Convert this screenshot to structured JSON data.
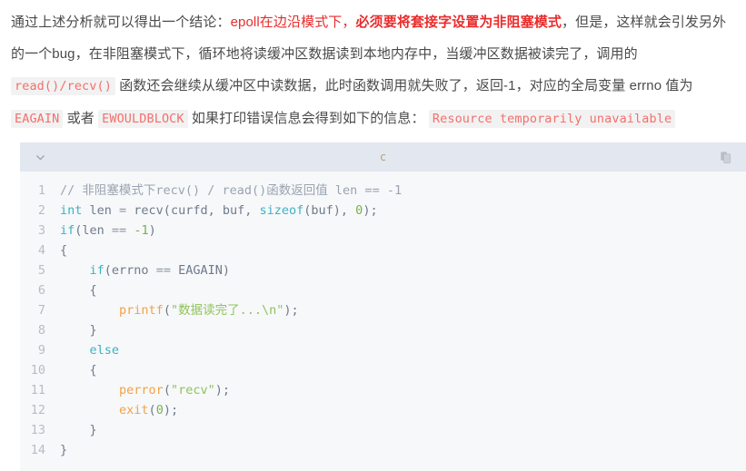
{
  "article": {
    "paragraph": {
      "seg1": "通过上述分析就可以得出一个结论：",
      "red1": "epoll在边沿模式下，",
      "red_bold": "必须要将套接字设置为非阻塞模式",
      "seg2": "，但是，这样就会引发另外的一个bug，在非阻塞模式下，循环地将读缓冲区数据读到本地内存中，当缓冲区数据被读完了，调用的 ",
      "code1": "read()/recv()",
      "seg3": " 函数还会继续从缓冲区中读数据，此时函数调用就失败了，返回-1，对应的全局变量 errno 值为 ",
      "code2": "EAGAIN",
      "seg4": " 或者 ",
      "code3": "EWOULDBLOCK",
      "seg5": " 如果打印错误信息会得到如下的信息： ",
      "code4": "Resource temporarily unavailable"
    }
  },
  "code_block": {
    "language_label": "c",
    "collapse_icon": "chevron-down-icon",
    "copy_icon": "copy-icon",
    "lines": [
      {
        "number": "1",
        "tokens": [
          {
            "text": "// 非阻塞模式下recv() / read()函数返回值 len == -1",
            "type": "comment"
          }
        ]
      },
      {
        "number": "2",
        "tokens": [
          {
            "text": "int",
            "type": "kw"
          },
          {
            "text": " len ",
            "type": "plain"
          },
          {
            "text": "=",
            "type": "op"
          },
          {
            "text": " recv(curfd, buf, ",
            "type": "plain"
          },
          {
            "text": "sizeof",
            "type": "kw"
          },
          {
            "text": "(buf), ",
            "type": "plain"
          },
          {
            "text": "0",
            "type": "num"
          },
          {
            "text": ");",
            "type": "plain"
          }
        ]
      },
      {
        "number": "3",
        "tokens": [
          {
            "text": "if",
            "type": "kw"
          },
          {
            "text": "(len ",
            "type": "plain"
          },
          {
            "text": "==",
            "type": "op"
          },
          {
            "text": " ",
            "type": "plain"
          },
          {
            "text": "-1",
            "type": "num"
          },
          {
            "text": ")",
            "type": "plain"
          }
        ]
      },
      {
        "number": "4",
        "tokens": [
          {
            "text": "{",
            "type": "plain"
          }
        ]
      },
      {
        "number": "5",
        "tokens": [
          {
            "text": "    ",
            "type": "plain"
          },
          {
            "text": "if",
            "type": "kw"
          },
          {
            "text": "(errno ",
            "type": "plain"
          },
          {
            "text": "==",
            "type": "op"
          },
          {
            "text": " EAGAIN)",
            "type": "plain"
          }
        ]
      },
      {
        "number": "6",
        "tokens": [
          {
            "text": "    {",
            "type": "plain"
          }
        ]
      },
      {
        "number": "7",
        "tokens": [
          {
            "text": "        ",
            "type": "plain"
          },
          {
            "text": "printf",
            "type": "fn"
          },
          {
            "text": "(",
            "type": "plain"
          },
          {
            "text": "\"数据读完了...\\n\"",
            "type": "str"
          },
          {
            "text": ");",
            "type": "plain"
          }
        ]
      },
      {
        "number": "8",
        "tokens": [
          {
            "text": "    }",
            "type": "plain"
          }
        ]
      },
      {
        "number": "9",
        "tokens": [
          {
            "text": "    ",
            "type": "plain"
          },
          {
            "text": "else",
            "type": "kw"
          }
        ]
      },
      {
        "number": "10",
        "tokens": [
          {
            "text": "    {",
            "type": "plain"
          }
        ]
      },
      {
        "number": "11",
        "tokens": [
          {
            "text": "        ",
            "type": "plain"
          },
          {
            "text": "perror",
            "type": "fn"
          },
          {
            "text": "(",
            "type": "plain"
          },
          {
            "text": "\"recv\"",
            "type": "str"
          },
          {
            "text": ");",
            "type": "plain"
          }
        ]
      },
      {
        "number": "12",
        "tokens": [
          {
            "text": "        ",
            "type": "plain"
          },
          {
            "text": "exit",
            "type": "fn"
          },
          {
            "text": "(",
            "type": "plain"
          },
          {
            "text": "0",
            "type": "num"
          },
          {
            "text": ");",
            "type": "plain"
          }
        ]
      },
      {
        "number": "13",
        "tokens": [
          {
            "text": "    }",
            "type": "plain"
          }
        ]
      },
      {
        "number": "14",
        "tokens": [
          {
            "text": "}",
            "type": "plain"
          }
        ]
      }
    ]
  },
  "colors": {
    "accent_red": "#e92b2b",
    "inline_code_text": "#f2706d",
    "inline_code_bg": "#f2f2f2",
    "code_header_bg": "#e3e7ef",
    "code_body_bg": "#f7f8fa",
    "lang_label": "#b3a37c"
  }
}
